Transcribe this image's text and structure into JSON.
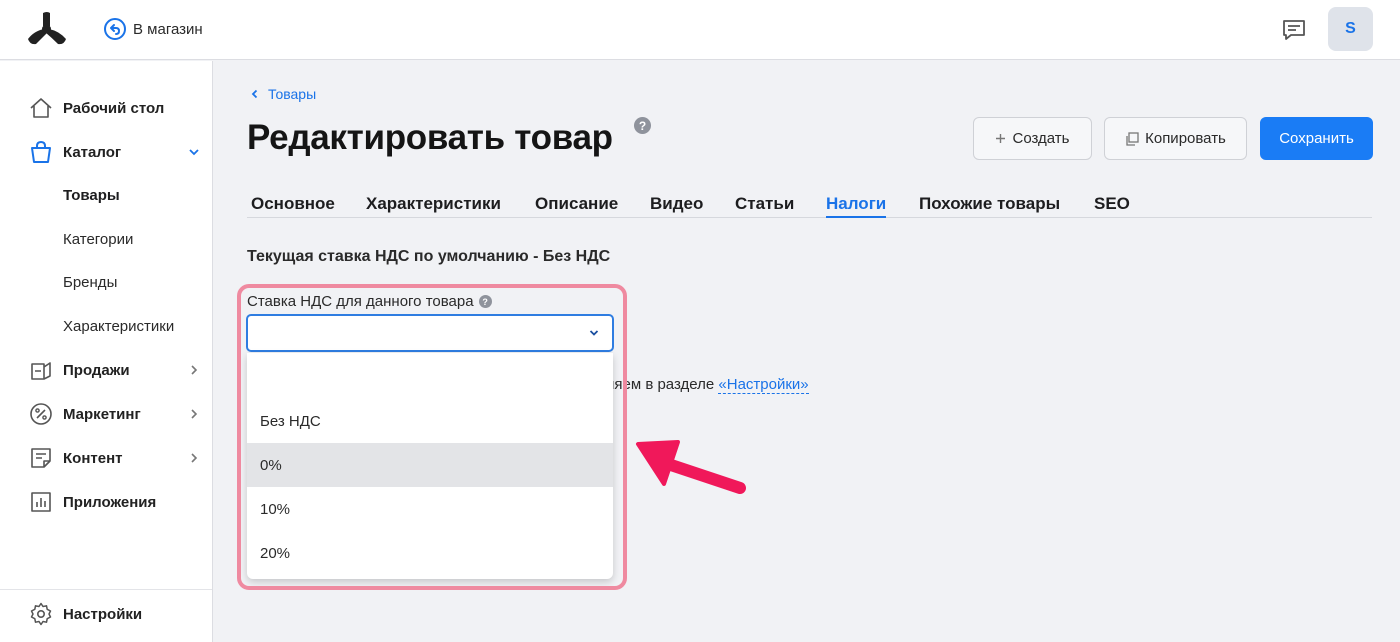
{
  "topbar": {
    "store_link_label": "В магазин",
    "avatar_letter": "S"
  },
  "sidebar": {
    "items": [
      {
        "label": "Рабочий стол",
        "icon": "home-icon"
      },
      {
        "label": "Каталог",
        "icon": "shopping-bag-icon",
        "expanded": true
      },
      {
        "label": "Продажи",
        "icon": "sales-icon"
      },
      {
        "label": "Маркетинг",
        "icon": "percent-icon"
      },
      {
        "label": "Контент",
        "icon": "document-icon"
      },
      {
        "label": "Приложения",
        "icon": "chart-icon"
      }
    ],
    "catalog_sub": [
      {
        "label": "Товары",
        "active": true
      },
      {
        "label": "Категории"
      },
      {
        "label": "Бренды"
      },
      {
        "label": "Характеристики"
      }
    ],
    "settings_label": "Настройки"
  },
  "breadcrumb": {
    "label": "Товары"
  },
  "page": {
    "title": "Редактировать товар",
    "help_glyph": "?"
  },
  "actions": {
    "create_label": "Создать",
    "copy_label": "Копировать",
    "save_label": "Сохранить"
  },
  "tabs": [
    "Основное",
    "Характеристики",
    "Описание",
    "Видео",
    "Статьи",
    "Налоги",
    "Похожие товары",
    "SEO"
  ],
  "active_tab": "Налоги",
  "taxes": {
    "default_vat_text": "Текущая ставка НДС по умолчанию - Без НДС",
    "field_label": "Ставка НДС для данного товара",
    "selected_value": "",
    "options": [
      "",
      "Без НДС",
      "0%",
      "10%",
      "20%"
    ],
    "highlighted_option": "0%",
    "behind_text": "вляем в разделе ",
    "settings_link": "«Настройки»"
  },
  "colors": {
    "accent": "#1a7cf5",
    "annotation": "#f0185a",
    "frame": "#ef8aa0"
  }
}
